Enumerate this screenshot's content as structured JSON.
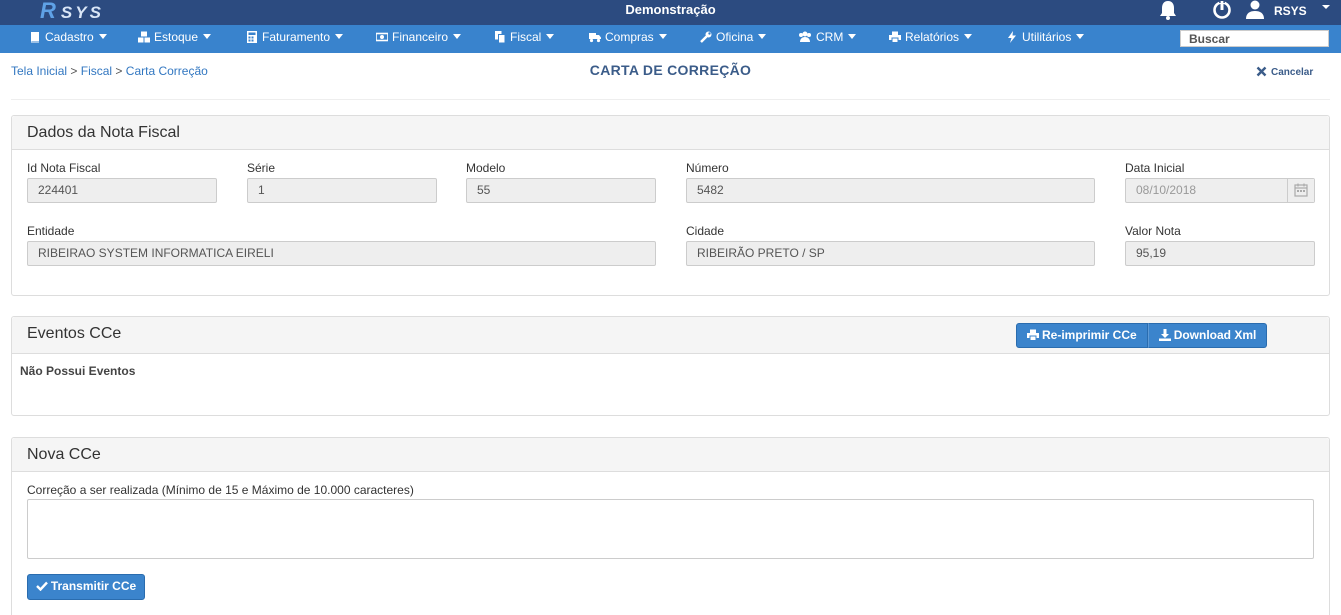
{
  "header": {
    "logo_text": "SYS",
    "logo_letter": "R",
    "app_title": "Demonstração",
    "user_name": "RSYS"
  },
  "menu": {
    "items": [
      {
        "label": "Cadastro",
        "icon": "book-icon"
      },
      {
        "label": "Estoque",
        "icon": "cubes-icon"
      },
      {
        "label": "Faturamento",
        "icon": "calculator-icon"
      },
      {
        "label": "Financeiro",
        "icon": "money-icon"
      },
      {
        "label": "Fiscal",
        "icon": "files-icon"
      },
      {
        "label": "Compras",
        "icon": "truck-icon"
      },
      {
        "label": "Oficina",
        "icon": "wrench-icon"
      },
      {
        "label": "CRM",
        "icon": "users-icon"
      },
      {
        "label": "Relatórios",
        "icon": "print-icon"
      },
      {
        "label": "Utilitários",
        "icon": "bolt-icon"
      }
    ],
    "search_placeholder": "Buscar"
  },
  "breadcrumb": {
    "home": "Tela Inicial",
    "sep": ">",
    "fiscal": "Fiscal",
    "current": "Carta Correção"
  },
  "page": {
    "title": "CARTA DE CORREÇÃO",
    "cancel_label": "Cancelar"
  },
  "nota_fiscal": {
    "title": "Dados da Nota Fiscal",
    "id_label": "Id Nota Fiscal",
    "id_value": "224401",
    "serie_label": "Série",
    "serie_value": "1",
    "modelo_label": "Modelo",
    "modelo_value": "55",
    "numero_label": "Número",
    "numero_value": "5482",
    "data_label": "Data Inicial",
    "data_value": "08/10/2018",
    "entidade_label": "Entidade",
    "entidade_value": "RIBEIRAO SYSTEM INFORMATICA EIRELI",
    "cidade_label": "Cidade",
    "cidade_value": "RIBEIRÃO PRETO / SP",
    "valor_label": "Valor Nota",
    "valor_value": "95,19"
  },
  "eventos": {
    "title": "Eventos CCe",
    "reprint_label": "Re-imprimir CCe",
    "download_label": "Download Xml",
    "empty_text": "Não Possui Eventos"
  },
  "nova": {
    "title": "Nova CCe",
    "correcao_label": "Correção a ser realizada (Mínimo de 15 e Máximo de 10.000 caracteres)",
    "correcao_value": "",
    "transmit_label": "Transmitir CCe"
  },
  "colors": {
    "topbar": "#2c4b80",
    "menubar": "#3983cd",
    "button": "#3b84cc",
    "title": "#3b5c89"
  }
}
